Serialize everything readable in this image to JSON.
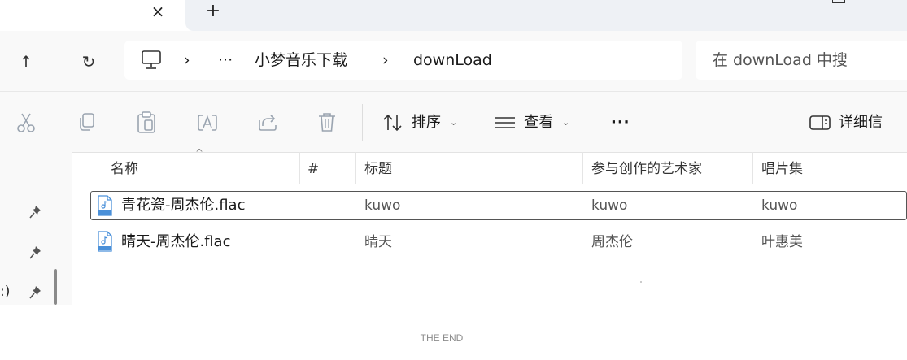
{
  "tabs": {
    "close_glyph": "×",
    "new_glyph": "+"
  },
  "nav": {
    "up_glyph": "↑",
    "refresh_glyph": "↻"
  },
  "address": {
    "chevron": "›",
    "more": "···",
    "crumbs": [
      "小梦音乐下载",
      "downLoad"
    ]
  },
  "search": {
    "placeholder": "在 downLoad 中搜"
  },
  "toolbar": {
    "sort_label": "排序",
    "view_label": "查看",
    "more_label": "···",
    "details_label": "详细信",
    "caret": "⌄"
  },
  "left_pane": {
    "fragment": ":)"
  },
  "columns": [
    "名称",
    "#",
    "标题",
    "参与创作的艺术家",
    "唱片集"
  ],
  "sort_indicator": "^",
  "files": [
    {
      "name": "青花瓷-周杰伦.flac",
      "number": "",
      "title": "kuwo",
      "artist": "kuwo",
      "album": "kuwo",
      "selected": true
    },
    {
      "name": "晴天-周杰伦.flac",
      "number": "",
      "title": "晴天",
      "artist": "周杰伦",
      "album": "叶惠美",
      "selected": false
    }
  ],
  "footer": {
    "end_text": "THE END"
  },
  "colors": {
    "icon_blue": "#4a90d9",
    "toolbar_disabled": "#9aa4b0",
    "text": "#1a1a1a"
  }
}
